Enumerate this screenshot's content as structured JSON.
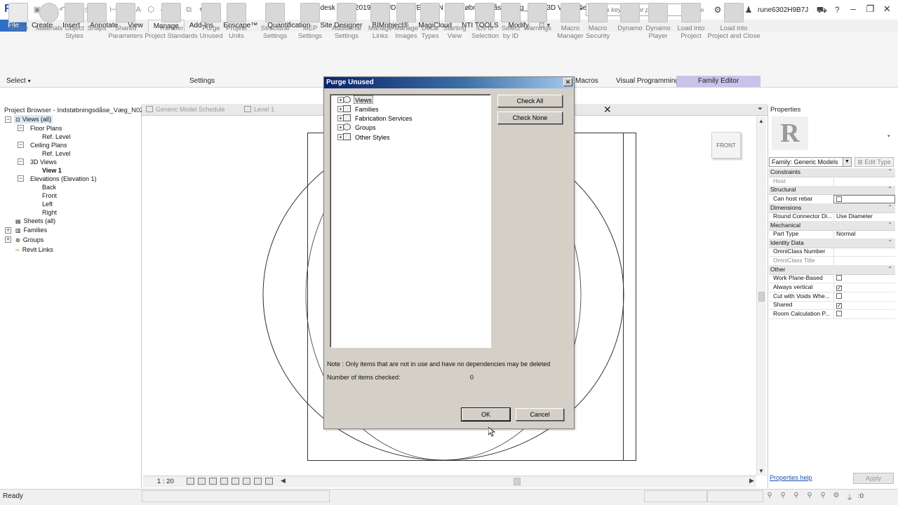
{
  "app": {
    "logo": "R",
    "window_title": "Autodesk Revit 2019 - STUDENT VERSION - Indstøbningsdåse_Væg_N02 - 3D View: View 1",
    "search_placeholder": "Type a keyword or phrase",
    "user": "rune6302H9B7J",
    "help_label": "?"
  },
  "ribbon_tabs": [
    "File",
    "Create",
    "Insert",
    "Annotate",
    "View",
    "Manage",
    "Add-Ins",
    "Enscape™",
    "Quantification",
    "Site Designer",
    "BIMobject®",
    "MagiCloud",
    "NTI TOOLS",
    "Modify"
  ],
  "active_tab": "Manage",
  "ribbon_buttons": [
    {
      "label": "Modify"
    },
    {
      "label": "Materials"
    },
    {
      "label": "Object\nStyles"
    },
    {
      "label": "Snaps"
    },
    {
      "label": "Shared\nParameters"
    },
    {
      "label": "Transfer\nProject Standards"
    },
    {
      "label": "Purge\nUnused"
    },
    {
      "label": "Project\nUnits"
    },
    {
      "label": "Structural\nSettings"
    },
    {
      "label": "MEP\nSettings"
    },
    {
      "label": "Additional\nSettings"
    },
    {
      "label": "Manage\nLinks"
    },
    {
      "label": "Manage\nImages"
    },
    {
      "label": "Decal\nTypes"
    },
    {
      "label": "Starting\nView"
    },
    {
      "label": "IDs of\nSelection"
    },
    {
      "label": "Select\nby ID"
    },
    {
      "label": "Warnings"
    },
    {
      "label": "Macro\nManager"
    },
    {
      "label": "Macro\nSecurity"
    },
    {
      "label": "Dynamo"
    },
    {
      "label": "Dynamo\nPlayer"
    },
    {
      "label": "Load into\nProject"
    },
    {
      "label": "Load into\nProject and Close"
    }
  ],
  "ribbon_panels": {
    "select": "Select",
    "settings": "Settings",
    "macros": "Macros",
    "visual_programming": "Visual Programming",
    "family_editor": "Family Editor"
  },
  "project_browser": {
    "title": "Project Browser - Indstøbningsdåse_Væg_N02",
    "items": [
      {
        "label": "Views (all)"
      },
      {
        "label": "Floor Plans"
      },
      {
        "label": "Ref. Level"
      },
      {
        "label": "Ceiling Plans"
      },
      {
        "label": "Ref. Level"
      },
      {
        "label": "3D Views"
      },
      {
        "label": "View 1"
      },
      {
        "label": "Elevations (Elevation 1)"
      },
      {
        "label": "Back"
      },
      {
        "label": "Front"
      },
      {
        "label": "Left"
      },
      {
        "label": "Right"
      },
      {
        "label": "Sheets (all)"
      },
      {
        "label": "Families"
      },
      {
        "label": "Groups"
      },
      {
        "label": "Revit Links"
      }
    ]
  },
  "view_tabs": [
    "Generic Model Schedule",
    "Level 1"
  ],
  "view_cube_label": "FRONT",
  "view_scale": "1 : 20",
  "properties": {
    "title": "Properties",
    "type_selector": "Family: Generic Models",
    "edit_type": "Edit Type",
    "rows": [
      {
        "kind": "group",
        "name": "Constraints"
      },
      {
        "kind": "param",
        "name": "Host",
        "value": "",
        "grey": true
      },
      {
        "kind": "group",
        "name": "Structural"
      },
      {
        "kind": "param",
        "name": "Can host rebar",
        "value": "",
        "checkbox": true,
        "checked": false
      },
      {
        "kind": "group",
        "name": "Dimensions"
      },
      {
        "kind": "param",
        "name": "Round Connector Di...",
        "value": "Use Diameter"
      },
      {
        "kind": "group",
        "name": "Mechanical"
      },
      {
        "kind": "param",
        "name": "Part Type",
        "value": "Normal"
      },
      {
        "kind": "group",
        "name": "Identity Data"
      },
      {
        "kind": "param",
        "name": "OmniClass Number",
        "value": ""
      },
      {
        "kind": "param",
        "name": "OmniClass Title",
        "value": "",
        "grey": true
      },
      {
        "kind": "group",
        "name": "Other"
      },
      {
        "kind": "param",
        "name": "Work Plane-Based",
        "value": "",
        "checkbox": true,
        "checked": false
      },
      {
        "kind": "param",
        "name": "Always vertical",
        "value": "",
        "checkbox": true,
        "checked": true
      },
      {
        "kind": "param",
        "name": "Cut with Voids Whe...",
        "value": "",
        "checkbox": true,
        "checked": false
      },
      {
        "kind": "param",
        "name": "Shared",
        "value": "",
        "checkbox": true,
        "checked": true
      },
      {
        "kind": "param",
        "name": "Room Calculation P...",
        "value": "",
        "checkbox": true,
        "checked": false
      }
    ],
    "help_link": "Properties help",
    "apply": "Apply"
  },
  "status_bar": {
    "text": "Ready",
    "filter_count": ":0"
  },
  "dialog": {
    "title": "Purge Unused",
    "tree": [
      "Views",
      "Families",
      "Fabrication Services",
      "Groups",
      "Other Styles"
    ],
    "check_all": "Check All",
    "check_none": "Check None",
    "note": "Note : Only items that are not in use and have no dependencies may be deleted",
    "count_label": "Number of items checked:",
    "count_value": "0",
    "ok": "OK",
    "cancel": "Cancel"
  }
}
